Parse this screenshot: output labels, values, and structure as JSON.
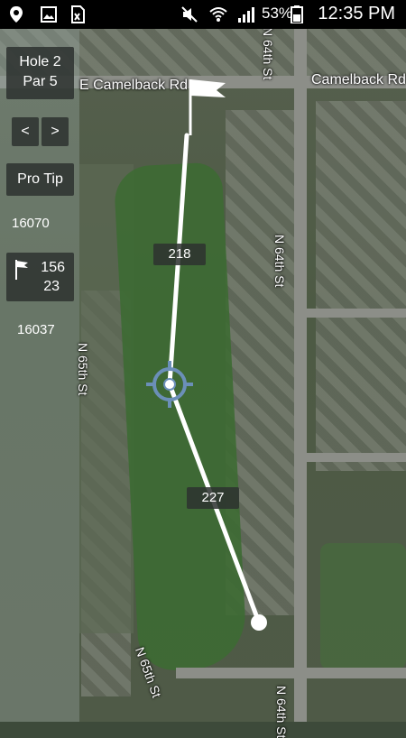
{
  "status_bar": {
    "battery_percent": "53%",
    "time": "12:35 PM"
  },
  "hole_info": {
    "hole": "Hole 2",
    "par": "Par 5"
  },
  "navigation": {
    "prev_label": "<",
    "next_label": ">"
  },
  "pro_tip_label": "Pro Tip",
  "stats": {
    "value_top": "16070",
    "flag_distance_1": "156",
    "flag_distance_2": "23",
    "value_bottom": "16037"
  },
  "distances": {
    "upper_segment": "218",
    "lower_segment": "227"
  },
  "map_labels": {
    "road_top_left": "E Camelback Rd",
    "road_top_right": "Camelback Rd",
    "street_64th_top": "N 64th St",
    "street_64th_mid": "N 64th St",
    "street_64th_bottom": "N 64th St",
    "street_65th_left": "N 65th St",
    "street_65th_bottom": "N 65th St"
  },
  "colors": {
    "overlay_panel": "#2d3230",
    "shot_line": "#ffffff",
    "target_reticle": "#6b8fb8"
  }
}
